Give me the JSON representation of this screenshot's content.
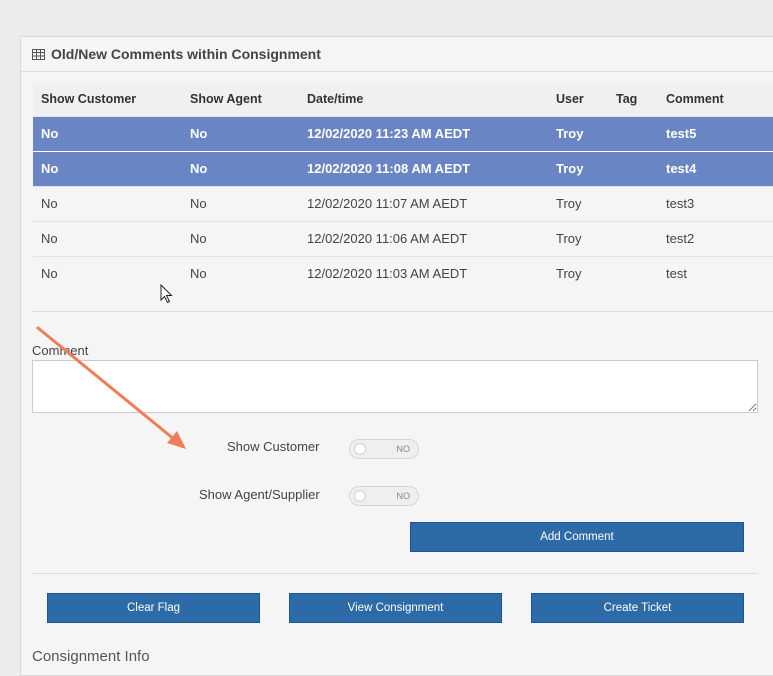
{
  "panel": {
    "title": "Old/New Comments within Consignment",
    "icon": "table-icon"
  },
  "table": {
    "headers": [
      "Show Customer",
      "Show Agent",
      "Date/time",
      "User",
      "Tag",
      "Comment"
    ],
    "rows": [
      {
        "show_customer": "No",
        "show_agent": "No",
        "datetime": "12/02/2020 11:23 AM AEDT",
        "user": "Troy",
        "tag": "",
        "comment": "test5",
        "selected": true
      },
      {
        "show_customer": "No",
        "show_agent": "No",
        "datetime": "12/02/2020 11:08 AM AEDT",
        "user": "Troy",
        "tag": "",
        "comment": "test4",
        "selected": true
      },
      {
        "show_customer": "No",
        "show_agent": "No",
        "datetime": "12/02/2020 11:07 AM AEDT",
        "user": "Troy",
        "tag": "",
        "comment": "test3",
        "selected": false
      },
      {
        "show_customer": "No",
        "show_agent": "No",
        "datetime": "12/02/2020 11:06 AM AEDT",
        "user": "Troy",
        "tag": "",
        "comment": "test2",
        "selected": false
      },
      {
        "show_customer": "No",
        "show_agent": "No",
        "datetime": "12/02/2020 11:03 AM AEDT",
        "user": "Troy",
        "tag": "",
        "comment": "test",
        "selected": false
      }
    ]
  },
  "form": {
    "comment_label": "Comment",
    "comment_value": "",
    "show_customer_label": "Show Customer",
    "show_customer_state": "NO",
    "show_agent_label": "Show Agent/Supplier",
    "show_agent_state": "NO",
    "add_comment_label": "Add Comment"
  },
  "actions": {
    "clear_flag_label": "Clear Flag",
    "view_consignment_label": "View Consignment",
    "create_ticket_label": "Create Ticket"
  },
  "consignment_info": {
    "title": "Consignment Info"
  },
  "colors": {
    "selected_row": "#6a85c4",
    "button": "#2d6aa8",
    "annotation_arrow": "#f07c5a"
  }
}
